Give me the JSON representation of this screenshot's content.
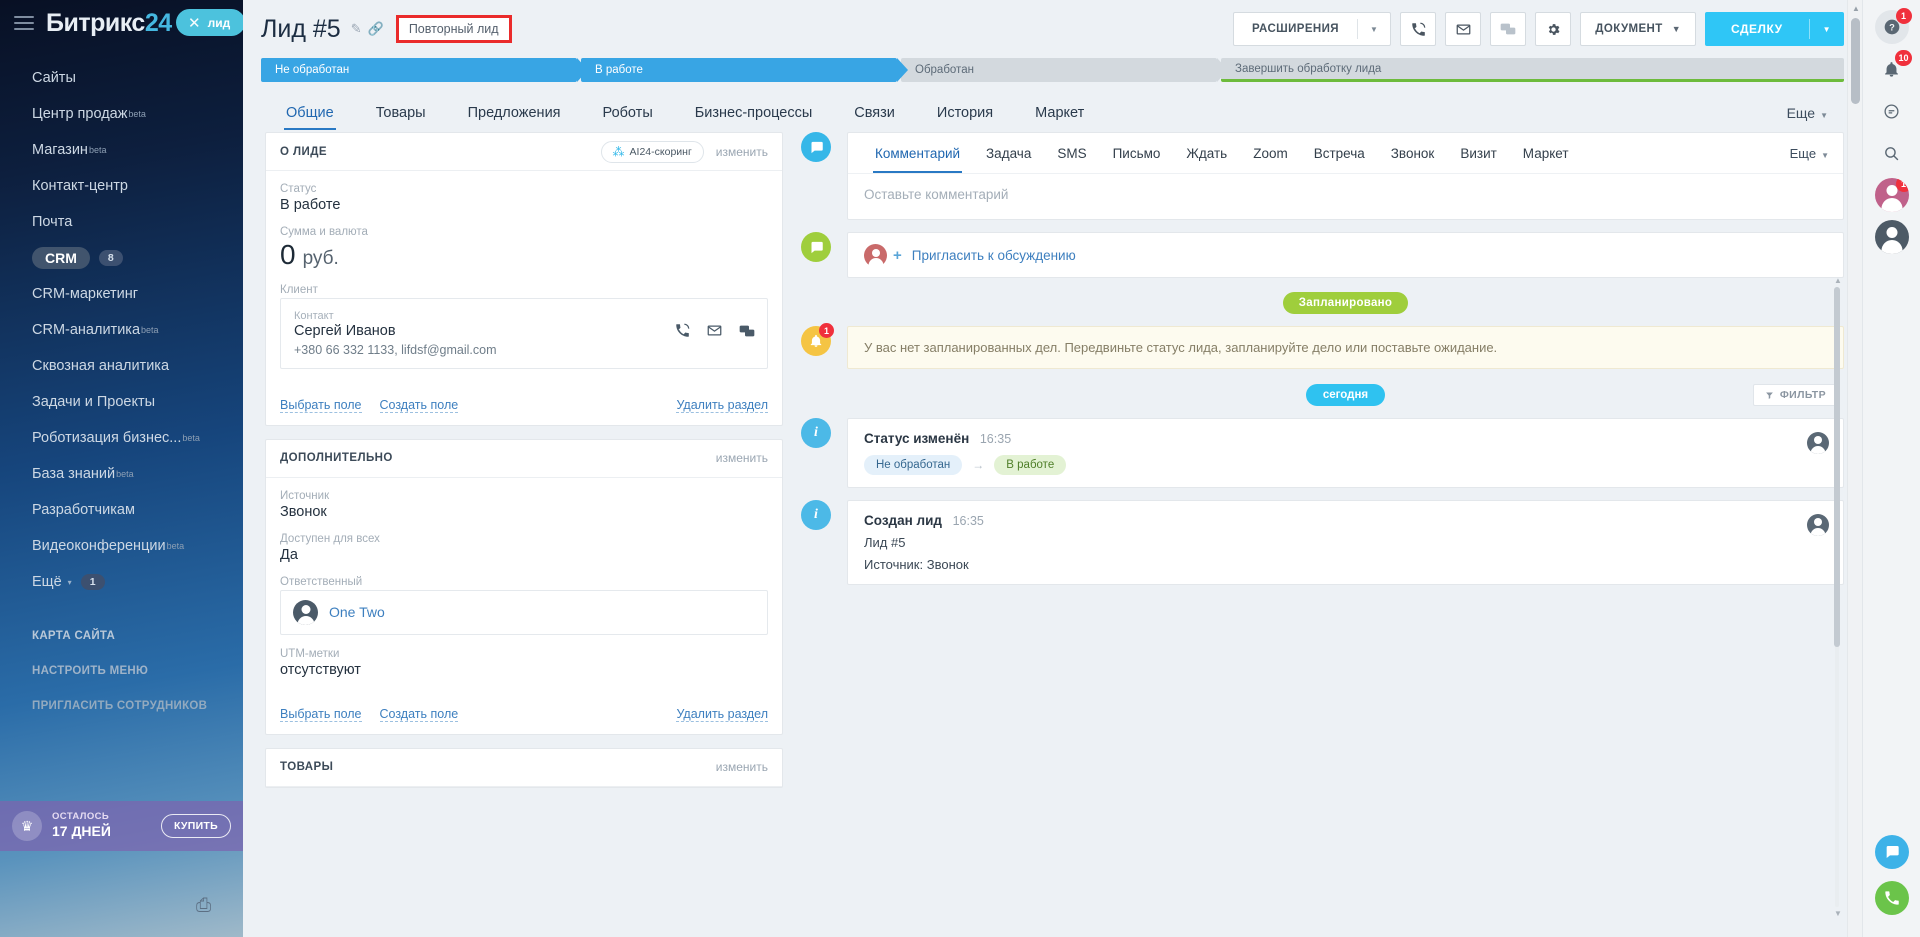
{
  "sidebar": {
    "logo_text": "Битрикс",
    "logo_num": "24",
    "lead_chip": {
      "close": "✕",
      "label": "лид"
    },
    "items": [
      {
        "label": "Сайты",
        "beta": "",
        "active": false,
        "count": ""
      },
      {
        "label": "Центр продаж",
        "beta": "beta",
        "active": false,
        "count": ""
      },
      {
        "label": "Магазин",
        "beta": "beta",
        "active": false,
        "count": ""
      },
      {
        "label": "Контакт-центр",
        "beta": "",
        "active": false,
        "count": ""
      },
      {
        "label": "Почта",
        "beta": "",
        "active": false,
        "count": ""
      },
      {
        "label": "CRM",
        "beta": "",
        "active": true,
        "count": "8"
      },
      {
        "label": "CRM-маркетинг",
        "beta": "",
        "active": false,
        "count": ""
      },
      {
        "label": "CRM-аналитика",
        "beta": "beta",
        "active": false,
        "count": ""
      },
      {
        "label": "Сквозная аналитика",
        "beta": "",
        "active": false,
        "count": ""
      },
      {
        "label": "Задачи и Проекты",
        "beta": "",
        "active": false,
        "count": ""
      },
      {
        "label": "Роботизация бизнес...",
        "beta": "beta",
        "active": false,
        "count": ""
      },
      {
        "label": "База знаний",
        "beta": "beta",
        "active": false,
        "count": ""
      },
      {
        "label": "Разработчикам",
        "beta": "",
        "active": false,
        "count": ""
      },
      {
        "label": "Видеоконференции",
        "beta": "beta",
        "active": false,
        "count": ""
      },
      {
        "label": "Ещё",
        "beta": "",
        "active": false,
        "count": "1"
      }
    ],
    "links": [
      "КАРТА САЙТА",
      "НАСТРОИТЬ МЕНЮ",
      "ПРИГЛАСИТЬ СОТРУДНИКОВ"
    ],
    "promo": {
      "top": "ОСТАЛОСЬ",
      "days": "17 ДНЕЙ",
      "buy": "КУПИТЬ"
    }
  },
  "header": {
    "title": "Лид #5",
    "repeat_badge": "Повторный лид",
    "buttons": {
      "extensions": "РАСШИРЕНИЯ",
      "document": "ДОКУМЕНТ",
      "deal": "СДЕЛКУ"
    }
  },
  "stages": [
    {
      "label": "Не обработан",
      "state": "done"
    },
    {
      "label": "В работе",
      "state": "current"
    },
    {
      "label": "Обработан",
      "state": "pending"
    },
    {
      "label": "Завершить обработку лида",
      "state": "final"
    }
  ],
  "tabs": {
    "items": [
      "Общие",
      "Товары",
      "Предложения",
      "Роботы",
      "Бизнес-процессы",
      "Связи",
      "История",
      "Маркет"
    ],
    "active": "Общие",
    "more": "Еще"
  },
  "about_card": {
    "title": "О ЛИДЕ",
    "ai_badge": "AI24-скоринг",
    "edit": "изменить",
    "fields": [
      {
        "label": "Статус",
        "value": "В работе"
      }
    ],
    "amount": {
      "label": "Сумма и валюта",
      "number": "0",
      "currency": "руб."
    },
    "client": {
      "label": "Клиент",
      "contact_label": "Контакт",
      "name": "Сергей Иванов",
      "meta": "+380 66 332 1133, lifdsf@gmail.com"
    },
    "footer": {
      "choose_field": "Выбрать поле",
      "create_field": "Создать поле",
      "delete_section": "Удалить раздел"
    }
  },
  "extra_card": {
    "title": "ДОПОЛНИТЕЛЬНО",
    "edit": "изменить",
    "fields": [
      {
        "label": "Источник",
        "value": "Звонок"
      },
      {
        "label": "Доступен для всех",
        "value": "Да"
      }
    ],
    "responsible": {
      "label": "Ответственный",
      "name": "One Two"
    },
    "utm": {
      "label": "UTM-метки",
      "value": "отсутствуют"
    },
    "footer": {
      "choose_field": "Выбрать поле",
      "create_field": "Создать поле",
      "delete_section": "Удалить раздел"
    }
  },
  "products_card": {
    "title": "ТОВАРЫ",
    "edit": "изменить"
  },
  "activity": {
    "comment_tabs": {
      "items": [
        "Комментарий",
        "Задача",
        "SMS",
        "Письмо",
        "Ждать",
        "Zoom",
        "Встреча",
        "Звонок",
        "Визит",
        "Маркет"
      ],
      "active": "Комментарий",
      "more": "Еще"
    },
    "comment_placeholder": "Оставьте комментарий",
    "invite": "Пригласить к обсуждению",
    "planned_badge": "Запланировано",
    "warning": "У вас нет запланированных дел. Передвиньте статус лида, запланируйте дело или поставьте ожидание.",
    "today_badge": "сегодня",
    "filter": "ФИЛЬТР",
    "history": [
      {
        "title": "Статус изменён",
        "time": "16:35",
        "chips": [
          "Не обработан",
          "В работе"
        ],
        "arrow": "→",
        "lines": []
      },
      {
        "title": "Создан лид",
        "time": "16:35",
        "chips": [],
        "arrow": "",
        "lines": [
          "Лид #5",
          "Источник: Звонок"
        ]
      }
    ]
  },
  "rail": {
    "help_badge": "1",
    "bell_badge": "10",
    "user_badge": "1"
  },
  "colors": {
    "accent": "#2fc6f6",
    "stage_active": "#38a5e4",
    "stage_pending": "#d3d9de",
    "stage_final_border": "#6dbb3c",
    "danger": "#ea2b2b",
    "green_badge": "#9fce3c",
    "link": "#3d7fbf"
  }
}
